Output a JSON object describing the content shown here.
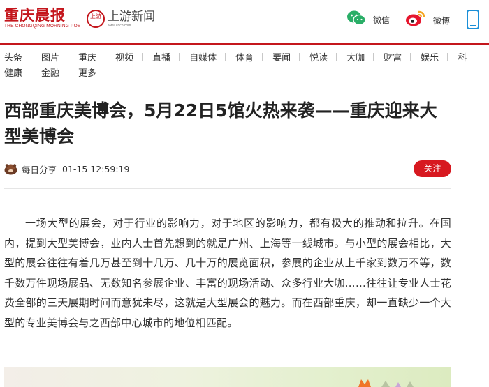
{
  "header": {
    "logo_cn": "重庆晨报",
    "logo_en": "THE CHONGQING MORNING POST",
    "logo2_badge": "上游",
    "logo2_name": "上游新闻",
    "logo2_url": "www.cqcb.com",
    "share": [
      {
        "label": "微信",
        "icon": "wechat-icon"
      },
      {
        "label": "微博",
        "icon": "weibo-icon"
      },
      {
        "icon": "mobile-icon"
      }
    ]
  },
  "nav": {
    "row1": [
      "头条",
      "图片",
      "重庆",
      "视频",
      "直播",
      "自媒体",
      "体育",
      "要闻",
      "悦读",
      "大咖",
      "财富",
      "娱乐",
      "科"
    ],
    "row2": [
      "健康",
      "金融",
      "更多"
    ]
  },
  "article": {
    "title": "西部重庆美博会，5月22日5馆火热来袭——重庆迎来大型美博会",
    "author": "每日分享",
    "time": "01-15 12:59:19",
    "follow_label": "关注",
    "paragraph": "一场大型的展会，对于行业的影响力，对于地区的影响力，都有极大的推动和拉升。在国内，提到大型美博会，业内人士首先想到的就是广州、上海等一线城市。与小型的展会相比，大型的展会往往有着几万甚至到十几万、几十万的展览面积，参展的企业从上千家到数万不等，数千数万件现场展品、无数知名参展企业、丰富的现场活动、众多行业大咖……往往让专业人士花费全部的三天展期时间而意犹未尽，这就是大型展会的魅力。而在西部重庆，却一直缺少一个大型的专业美博会与之西部中心城市的地位相匹配。"
  },
  "colors": {
    "brand_red": "#c4161c",
    "follow_red": "#d71920",
    "wechat_green": "#2aae67",
    "weibo_red": "#e6162d",
    "mobile_blue": "#1a8fd8"
  }
}
